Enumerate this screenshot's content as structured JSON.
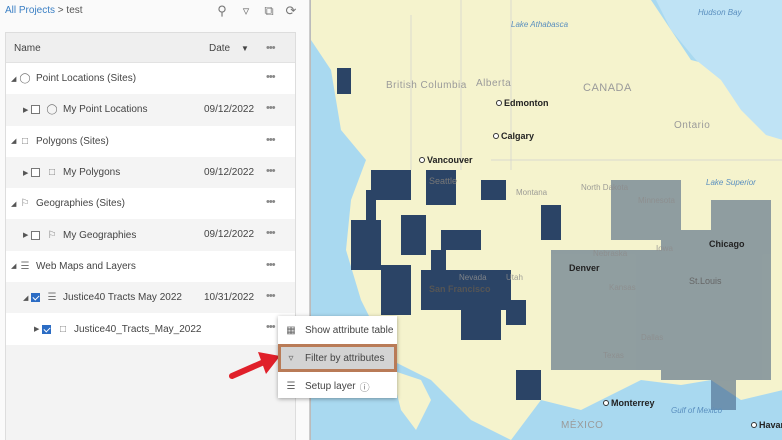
{
  "breadcrumb": {
    "root": "All Projects",
    "separator": " > ",
    "current": "test"
  },
  "toolbar": {
    "icons": [
      "search-icon",
      "filter-icon",
      "export-icon",
      "refresh-icon"
    ]
  },
  "table": {
    "col_name": "Name",
    "col_date": "Date",
    "rows": [
      {
        "label": "Point Locations (Sites)",
        "date": ""
      },
      {
        "label": "My Point Locations",
        "date": "09/12/2022"
      },
      {
        "label": "Polygons (Sites)",
        "date": ""
      },
      {
        "label": "My Polygons",
        "date": "09/12/2022"
      },
      {
        "label": "Geographies (Sites)",
        "date": ""
      },
      {
        "label": "My Geographies",
        "date": "09/12/2022"
      },
      {
        "label": "Web Maps and Layers",
        "date": ""
      },
      {
        "label": "Justice40 Tracts May 2022",
        "date": "10/31/2022"
      },
      {
        "label": "Justice40_Tracts_May_2022",
        "date": ""
      }
    ]
  },
  "context_menu": {
    "items": [
      "Show attribute table",
      "Filter by attributes",
      "Setup layer"
    ]
  },
  "map": {
    "cities": [
      "Edmonton",
      "Calgary",
      "Vancouver",
      "Seattle",
      "Chicago",
      "Denver",
      "St.Louis",
      "Monterrey",
      "Havana",
      "San Francisco"
    ],
    "regions": [
      "British Columbia",
      "Alberta",
      "CANADA",
      "Ontario",
      "North Dakota",
      "Montana",
      "Minnesota",
      "Nevada",
      "Utah",
      "Kansas",
      "Nebraska",
      "Iowa",
      "Texas",
      "Dallas",
      "MÉXICO"
    ],
    "water": [
      "Hudson Bay",
      "Lake Athabasca",
      "Lake Superior",
      "Gulf of Mexico"
    ],
    "colors": {
      "ocean": "#a9d9f0",
      "land": "#f5f3cd",
      "tracts": "#2b4466",
      "highlight_border": "#b97b57",
      "arrow": "#e0202a"
    }
  }
}
